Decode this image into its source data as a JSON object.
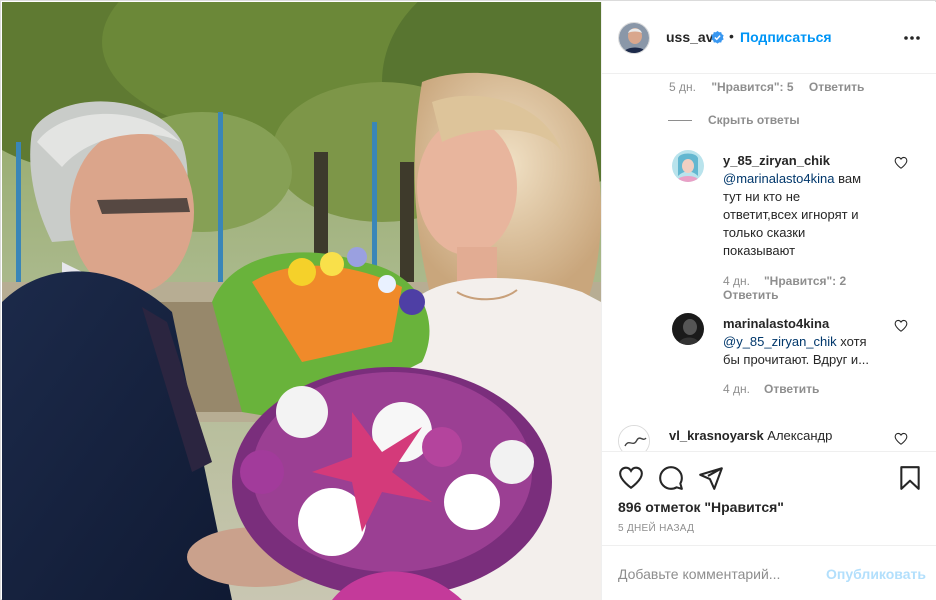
{
  "post": {
    "photo_alt": "",
    "author": {
      "username": "uss_av",
      "verified": true,
      "separator": "•",
      "follow_label": "Подписаться"
    },
    "menu_icon": "more-horizontal-icon"
  },
  "comments": {
    "top_meta": {
      "time": "5 дн.",
      "likes": "\"Нравится\": 5",
      "reply": "Ответить"
    },
    "hide_replies_label": "Скрыть ответы",
    "replies": [
      {
        "username": "y_85_ziryan_chik",
        "mention": "@marinalasto4kina",
        "text": " вам тут ни кто не ответит,всех игнорят и только сказки показывают",
        "time": "4 дн.",
        "likes": "\"Нравится\": 2",
        "reply": "Ответить"
      },
      {
        "username": "marinalasto4kina",
        "mention": "@y_85_ziryan_chik",
        "text": " хотя бы прочитают. Вдруг и...",
        "time": "4 дн.",
        "reply": "Ответить"
      }
    ],
    "last_comment": {
      "username": "vl_krasnoyarsk",
      "text": " Александр"
    }
  },
  "actions": {
    "like_icon": "heart-icon",
    "comment_icon": "comment-icon",
    "share_icon": "paper-plane-icon",
    "save_icon": "bookmark-icon",
    "likes_text": "896 отметок \"Нравится\"",
    "date_text": "5 дней назад"
  },
  "add_comment": {
    "placeholder": "Добавьте комментарий...",
    "post_label": "Опубликовать"
  },
  "colors": {
    "accent": "#0095f6",
    "accent_disabled": "#b2dffc",
    "text": "#262626",
    "muted": "#8e8e8e",
    "border": "#efefef",
    "mention": "#00376b",
    "verified": "#3897f0"
  }
}
